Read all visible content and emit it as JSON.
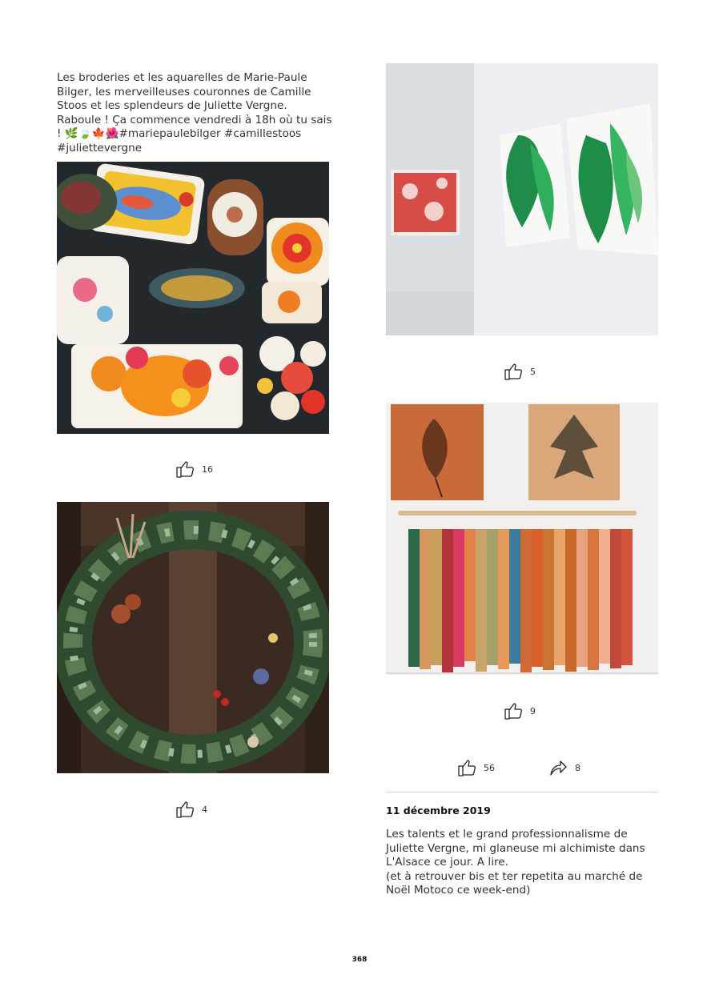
{
  "left_post": {
    "caption": "Les broderies et les aquarelles de Marie-Paule Bilger, les merveilleuses couronnes de Camille Stoos et les splendeurs de Juliette Vergne. Raboule ! Ça commence vendredi à 18h où tu sais ! 🌿🍃🍁🌺#mariepaulebilger #camillestoos #juliettevergne",
    "photo1_likes": "16",
    "photo2_likes": "4"
  },
  "right_post": {
    "photo1_likes": "5",
    "photo2_likes": "9",
    "total_likes": "56",
    "shares": "8"
  },
  "next_post": {
    "date": "11 décembre 2019",
    "text": "Les talents et le grand professionnalisme de Juliette Vergne, mi glaneuse mi alchimiste dans L'Alsace ce jour. A lire.\n(et à retrouver bis et ter repetita au marché de Noël Motoco ce week-end)"
  },
  "page_number": "368",
  "icons": {
    "like": "thumbs-up-icon",
    "share": "share-arrow-icon"
  },
  "colors": {
    "divider": "#d6d6d6",
    "text": "#333333"
  }
}
